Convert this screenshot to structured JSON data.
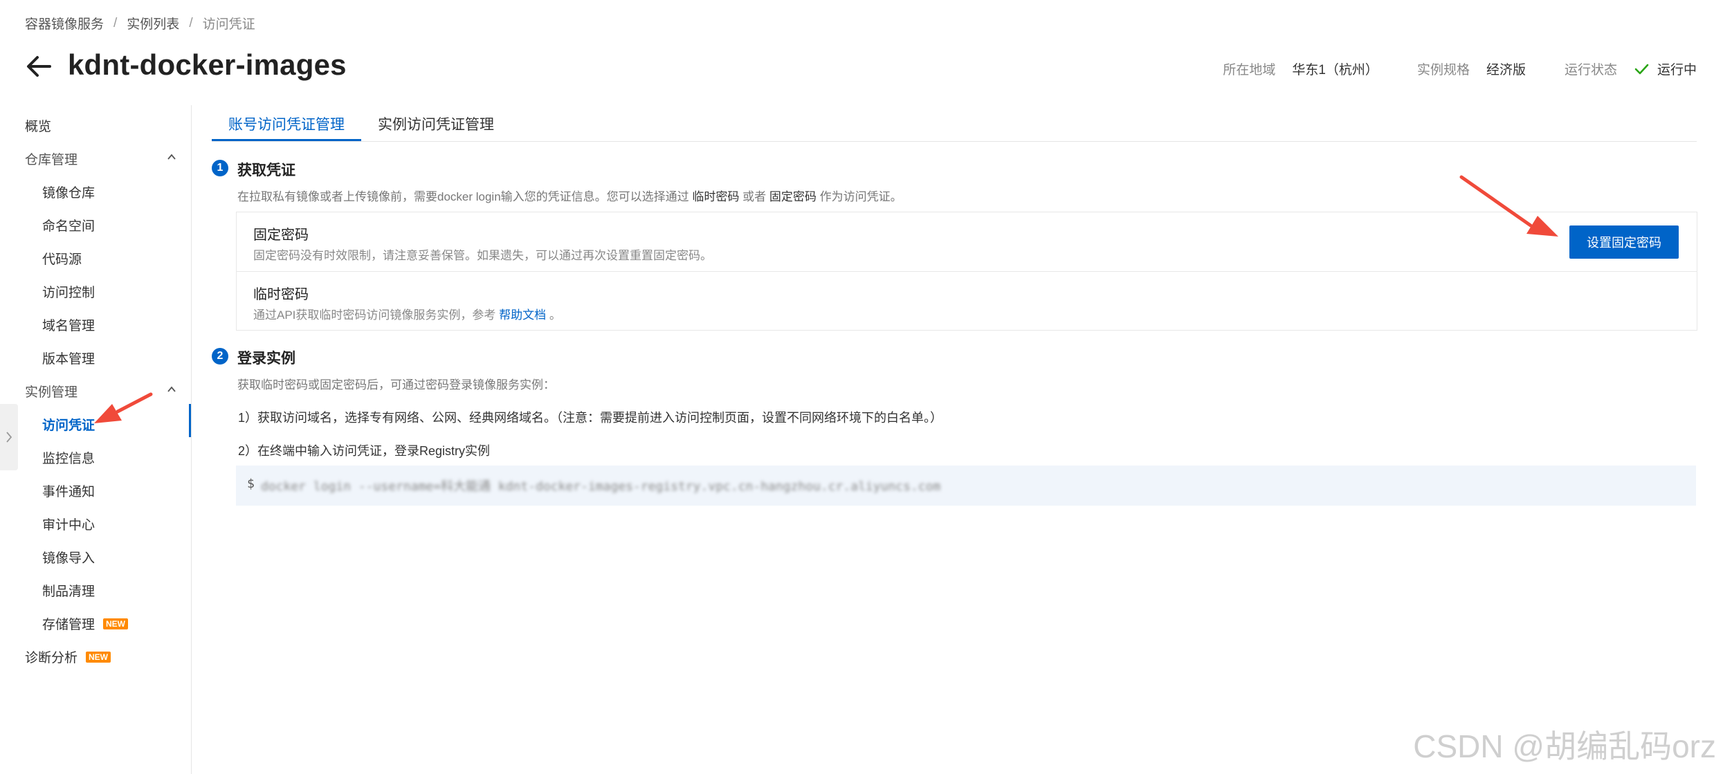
{
  "breadcrumb": [
    "容器镜像服务",
    "实例列表",
    "访问凭证"
  ],
  "header": {
    "title": "kdnt-docker-images",
    "region_label": "所在地域",
    "region_value": "华东1（杭州）",
    "spec_label": "实例规格",
    "spec_value": "经济版",
    "status_label": "运行状态",
    "status_value": "运行中"
  },
  "sidebar": {
    "overview": "概览",
    "repo_group": "仓库管理",
    "repo_items": [
      "镜像仓库",
      "命名空间",
      "代码源",
      "访问控制",
      "域名管理",
      "版本管理"
    ],
    "instance_group": "实例管理",
    "instance_items": [
      "访问凭证",
      "监控信息",
      "事件通知",
      "审计中心",
      "镜像导入",
      "制品清理",
      "存储管理"
    ],
    "diagnose": "诊断分析",
    "new_badge": "NEW",
    "active": "访问凭证"
  },
  "tabs": [
    "账号访问凭证管理",
    "实例访问凭证管理"
  ],
  "step1": {
    "num": "1",
    "title": "获取凭证",
    "desc_prefix": "在拉取私有镜像或者上传镜像前，需要docker login输入您的凭证信息。您可以选择通过",
    "desc_temp": "临时密码",
    "desc_or": "或者",
    "desc_fixed": "固定密码",
    "desc_suffix": "作为访问凭证。",
    "fixed_title": "固定密码",
    "fixed_desc": "固定密码没有时效限制，请注意妥善保管。如果遗失，可以通过再次设置重置固定密码。",
    "set_button": "设置固定密码",
    "temp_title": "临时密码",
    "temp_desc": "通过API获取临时密码访问镜像服务实例，参考",
    "help_link": "帮助文档",
    "temp_desc_end": "。"
  },
  "step2": {
    "num": "2",
    "title": "登录实例",
    "desc": "获取临时密码或固定密码后，可通过密码登录镜像服务实例：",
    "line1": "1）获取访问域名，选择专有网络、公网、经典网络域名。（注意：需要提前进入访问控制页面，设置不同网络环境下的白名单。）",
    "line2": "2）在终端中输入访问凭证，登录Registry实例",
    "code_prompt": "$",
    "code_blurred": "docker login --username=科大能通 kdnt-docker-images-registry.vpc.cn-hangzhou.cr.aliyuncs.com"
  },
  "watermark": "CSDN @胡编乱码orz",
  "colors": {
    "accent": "#0064c8",
    "status_ok": "#2aa515",
    "annotation": "#f04a3a",
    "badge": "#ff8a00"
  }
}
